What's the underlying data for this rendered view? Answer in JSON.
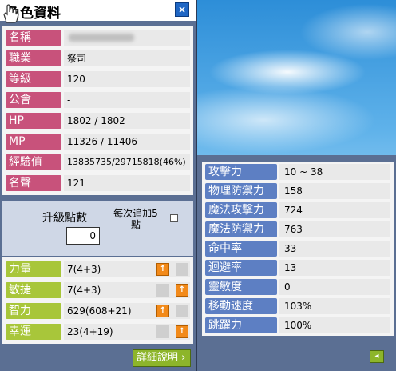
{
  "window": {
    "title": "角色資料",
    "close_glyph": "×"
  },
  "profile": [
    {
      "label": "名稱",
      "value": ""
    },
    {
      "label": "職業",
      "value": "祭司"
    },
    {
      "label": "等級",
      "value": "120"
    },
    {
      "label": "公會",
      "value": "-"
    },
    {
      "label": "HP",
      "value": "1802 / 1802"
    },
    {
      "label": "MP",
      "value": "11326 / 11406"
    },
    {
      "label": "經驗值",
      "value": "13835735/29715818(46%)"
    },
    {
      "label": "名聲",
      "value": "121"
    }
  ],
  "points": {
    "label": "升級點數",
    "value": "0",
    "auto_add_label": "每次追加5點",
    "auto_add_checked": false
  },
  "stats": [
    {
      "label": "力量",
      "value": "7(4+3)"
    },
    {
      "label": "敏捷",
      "value": "7(4+3)"
    },
    {
      "label": "智力",
      "value": "629(608+21)"
    },
    {
      "label": "幸運",
      "value": "23(4+19)"
    }
  ],
  "plus_glyph": "↑",
  "detail_button": "詳細說明 ›",
  "combat": [
    {
      "label": "攻擊力",
      "value": "10 ~ 38"
    },
    {
      "label": "物理防禦力",
      "value": "158"
    },
    {
      "label": "魔法攻擊力",
      "value": "724"
    },
    {
      "label": "魔法防禦力",
      "value": "763"
    },
    {
      "label": "命中率",
      "value": "33"
    },
    {
      "label": "迴避率",
      "value": "13"
    },
    {
      "label": "靈敏度",
      "value": "0"
    },
    {
      "label": "移動速度",
      "value": "103%"
    },
    {
      "label": "跳躍力",
      "value": "100%"
    }
  ],
  "collapse_glyph": "◂",
  "colors": {
    "profile_label": "#c8527b",
    "stat_label": "#a8c63a",
    "combat_label": "#5d7fc3",
    "plus_button": "#f28a1a",
    "frame": "#5b6f93"
  }
}
